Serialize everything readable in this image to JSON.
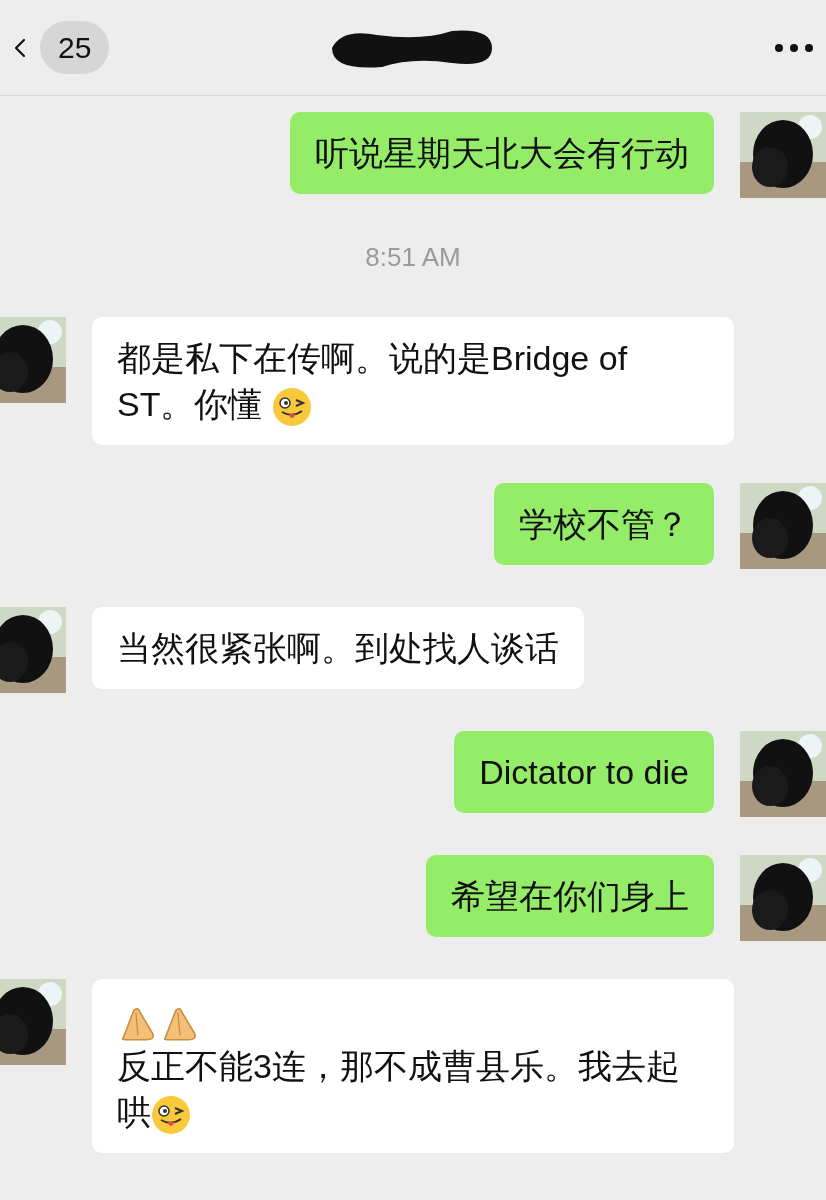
{
  "header": {
    "back_badge": "25",
    "title_redacted": true
  },
  "messages": [
    {
      "kind": "message",
      "outgoing": true,
      "parts": [
        {
          "kind": "text",
          "text": "听说星期天北大会有行动"
        }
      ]
    },
    {
      "kind": "time",
      "text": "8:51 AM"
    },
    {
      "kind": "message",
      "outgoing": false,
      "parts": [
        {
          "kind": "text",
          "text": "都是私下在传啊。说的是Bridge of ST。你懂 "
        },
        {
          "kind": "wink"
        }
      ]
    },
    {
      "kind": "message",
      "outgoing": true,
      "parts": [
        {
          "kind": "text",
          "text": "学校不管？"
        }
      ]
    },
    {
      "kind": "message",
      "outgoing": false,
      "parts": [
        {
          "kind": "text",
          "text": "当然很紧张啊。到处找人谈话"
        }
      ]
    },
    {
      "kind": "message",
      "outgoing": true,
      "parts": [
        {
          "kind": "text",
          "text": "Dictator to die"
        }
      ]
    },
    {
      "kind": "message",
      "outgoing": true,
      "parts": [
        {
          "kind": "text",
          "text": "希望在你们身上"
        }
      ]
    },
    {
      "kind": "message",
      "outgoing": false,
      "parts": [
        {
          "kind": "hands"
        },
        {
          "kind": "hands"
        },
        {
          "kind": "break"
        },
        {
          "kind": "text",
          "text": "反正不能3连，那不成曹县乐。我去起哄"
        },
        {
          "kind": "wink"
        }
      ]
    }
  ]
}
